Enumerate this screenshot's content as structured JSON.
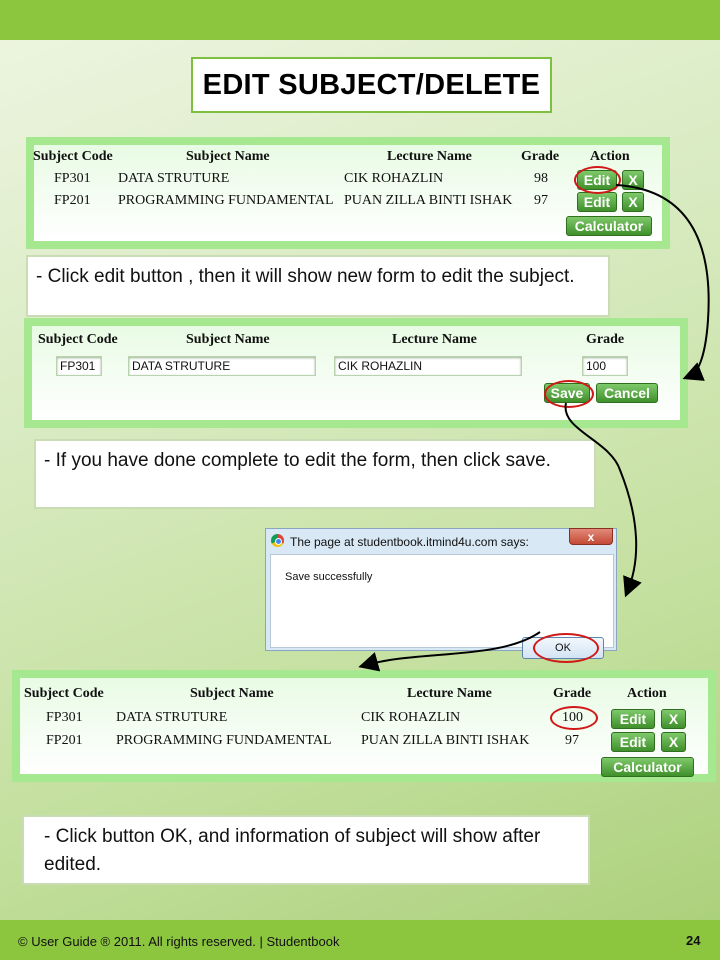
{
  "title": "EDIT SUBJECT/DELETE",
  "table1": {
    "headers": [
      "Subject Code",
      "Subject Name",
      "Lecture Name",
      "Grade",
      "Action"
    ],
    "rows": [
      {
        "code": "FP301",
        "name": "DATA STRUTURE",
        "lecturer": "CIK ROHAZLIN",
        "grade": "98"
      },
      {
        "code": "FP201",
        "name": "PROGRAMMING FUNDAMENTAL",
        "lecturer": "PUAN ZILLA BINTI ISHAK",
        "grade": "97"
      }
    ],
    "edit_label": "Edit",
    "delete_label": "X",
    "calculator_label": "Calculator"
  },
  "note1": "- Click edit button , then it will show new form to edit the subject.",
  "edit_form": {
    "headers": [
      "Subject Code",
      "Subject Name",
      "Lecture Name",
      "Grade"
    ],
    "code": "FP301",
    "name": "DATA STRUTURE",
    "lecturer": "CIK ROHAZLIN",
    "grade": "100",
    "save_label": "Save",
    "cancel_label": "Cancel"
  },
  "note2": "- If you have done complete to edit the form, then click save.",
  "dialog": {
    "title": "The page at studentbook.itmind4u.com says:",
    "close_label": "x",
    "message": "Save successfully",
    "ok_label": "OK"
  },
  "table2": {
    "headers": [
      "Subject Code",
      "Subject Name",
      "Lecture Name",
      "Grade",
      "Action"
    ],
    "rows": [
      {
        "code": "FP301",
        "name": "DATA STRUTURE",
        "lecturer": "CIK ROHAZLIN",
        "grade": "100"
      },
      {
        "code": "FP201",
        "name": "PROGRAMMING FUNDAMENTAL",
        "lecturer": "PUAN ZILLA BINTI ISHAK",
        "grade": "97"
      }
    ],
    "edit_label": "Edit",
    "delete_label": "X",
    "calculator_label": "Calculator"
  },
  "note3": "- Click button OK, and information of subject will show after edited.",
  "footer": "© User Guide ® 2011. All rights reserved. | Studentbook",
  "page_number": "24",
  "colors": {
    "accent_green": "#8cc63f",
    "button_green": "#3f8f2b",
    "highlight_red": "#d01818"
  },
  "icons": [
    "chrome-icon",
    "close-icon",
    "flow-arrow-icon"
  ]
}
